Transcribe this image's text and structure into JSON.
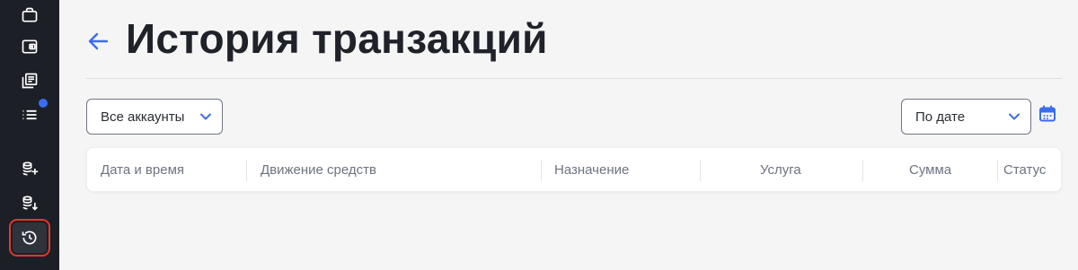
{
  "sidebar": {
    "items": [
      {
        "icon": "briefcase-icon"
      },
      {
        "icon": "wallet-icon"
      },
      {
        "icon": "documents-icon"
      },
      {
        "icon": "list-icon",
        "badge": true
      },
      {
        "icon": "coins-add-icon"
      },
      {
        "icon": "coins-withdraw-icon"
      },
      {
        "icon": "history-icon",
        "active": true
      }
    ]
  },
  "header": {
    "title": "История транзакций"
  },
  "filters": {
    "accounts_label": "Все аккаунты",
    "sort_label": "По дате"
  },
  "table": {
    "columns": [
      "Дата и время",
      "Движение средств",
      "Назначение",
      "Услуга",
      "Сумма",
      "Статус"
    ]
  },
  "colors": {
    "accent": "#3b6cf0",
    "sidebar": "#1c1f26",
    "highlight": "#e2372b"
  }
}
